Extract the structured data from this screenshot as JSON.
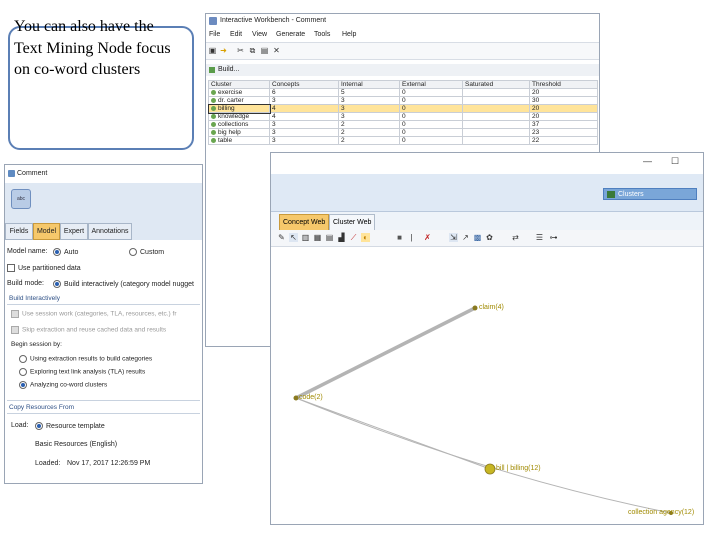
{
  "callout": {
    "text": "You can also have the Text Mining Node focus on co-word clusters"
  },
  "workbench": {
    "title": "Interactive Workbench - Comment",
    "menu": [
      "File",
      "Edit",
      "View",
      "Generate",
      "Tools",
      "Help"
    ],
    "build_label": "Build...",
    "columns": [
      "Cluster",
      "Concepts",
      "Internal",
      "External",
      "Saturated",
      "Threshold"
    ],
    "rows": [
      {
        "name": "exercise",
        "concepts": "6",
        "internal": "5",
        "external": "0",
        "saturated": "",
        "threshold": "20"
      },
      {
        "name": "dr. carter",
        "concepts": "3",
        "internal": "3",
        "external": "0",
        "saturated": "",
        "threshold": "30"
      },
      {
        "name": "billing",
        "concepts": "4",
        "internal": "3",
        "external": "0",
        "saturated": "",
        "threshold": "20"
      },
      {
        "name": "knowledge",
        "concepts": "4",
        "internal": "3",
        "external": "0",
        "saturated": "",
        "threshold": "20"
      },
      {
        "name": "collections",
        "concepts": "3",
        "internal": "2",
        "external": "0",
        "saturated": "",
        "threshold": "37"
      },
      {
        "name": "big help",
        "concepts": "3",
        "internal": "2",
        "external": "0",
        "saturated": "",
        "threshold": "23"
      },
      {
        "name": "table",
        "concepts": "3",
        "internal": "2",
        "external": "0",
        "saturated": "",
        "threshold": "22"
      }
    ],
    "selected_row": 2
  },
  "comment": {
    "title": "Comment",
    "node_icon_label": "abc",
    "tabs": [
      "Fields",
      "Model",
      "Expert",
      "Annotations"
    ],
    "active_tab": "Model",
    "model_name_label": "Model name:",
    "model_name_auto": "Auto",
    "model_name_custom": "Custom",
    "use_partitioned": "Use partitioned data",
    "build_mode_label": "Build mode:",
    "build_mode_value": "Build interactively (category model nugget",
    "build_interactively_hdr": "Build Interactively",
    "use_session_work": "Use session work (categories, TLA, resources, etc.) fr",
    "skip_extraction": "Skip extraction and reuse cached data and results",
    "begin_session_label": "Begin session by:",
    "begin_options": [
      "Using extraction results to build categories",
      "Exploring text link analysis (TLA) results",
      "Analyzing co-word clusters"
    ],
    "begin_selected": 2,
    "copy_resources_hdr": "Copy Resources From",
    "load_label": "Load:",
    "load_value": "Resource template",
    "basic_resources": "Basic Resources (English)",
    "loaded_label": "Loaded:",
    "loaded_value": "Nov 17, 2017 12:26:59 PM"
  },
  "cluster_viewer": {
    "clusters_button": "Clusters",
    "tabs": [
      "Concept Web",
      "Cluster Web"
    ],
    "active_tab": "Concept Web",
    "nodes": [
      {
        "id": "claim",
        "label": "claim(4)"
      },
      {
        "id": "code",
        "label": "code(2)"
      },
      {
        "id": "billing",
        "label": "bill | billing(12)"
      },
      {
        "id": "collection",
        "label": "collection agency(12)"
      }
    ],
    "edges": [
      {
        "from": "claim",
        "to": "code",
        "weight": "strong"
      },
      {
        "from": "code",
        "to": "billing",
        "weight": "weak"
      },
      {
        "from": "code",
        "to": "collection",
        "weight": "weak"
      }
    ]
  },
  "colors": {
    "accent": "#f6c86b",
    "node_label": "#a08a00",
    "window_border": "#9aa5b5"
  }
}
